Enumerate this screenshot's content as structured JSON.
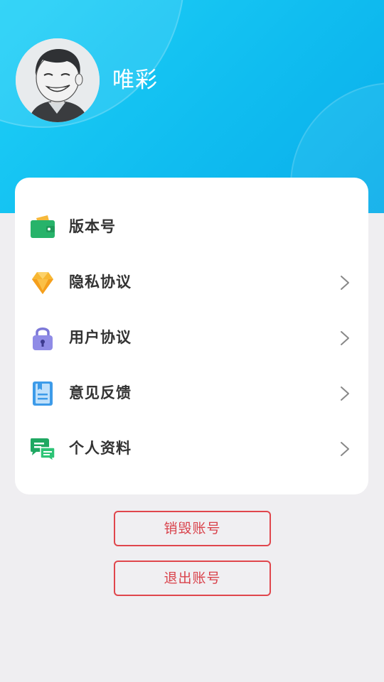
{
  "profile": {
    "name": "唯彩"
  },
  "menu": {
    "items": [
      {
        "label": "版本号",
        "icon": "wallet-icon",
        "has_chevron": false
      },
      {
        "label": "隐私协议",
        "icon": "diamond-icon",
        "has_chevron": true
      },
      {
        "label": "用户协议",
        "icon": "lock-icon",
        "has_chevron": true
      },
      {
        "label": "意见反馈",
        "icon": "document-icon",
        "has_chevron": true
      },
      {
        "label": "个人资料",
        "icon": "chat-icon",
        "has_chevron": true
      }
    ]
  },
  "actions": {
    "delete_account": "销毁账号",
    "logout": "退出账号"
  },
  "colors": {
    "header_gradient_start": "#1fd0f7",
    "header_gradient_end": "#0aaeea",
    "page_background": "#efeef1",
    "danger": "#e0464c"
  }
}
